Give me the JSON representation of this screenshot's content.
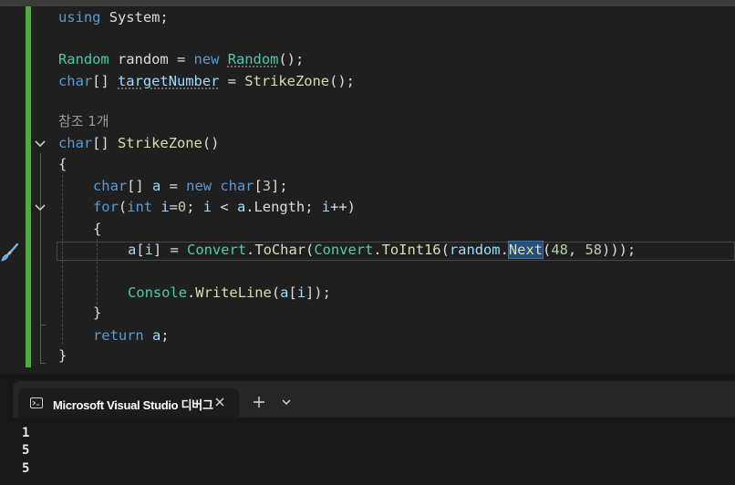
{
  "editor": {
    "lines": {
      "l1": {
        "kw": "using",
        "rest": " System;"
      },
      "l3": {
        "t1": "Random",
        "t2": " random = ",
        "kw": "new",
        "sp": " ",
        "t3": "Random",
        "t4": "();"
      },
      "l4": {
        "kw": "char",
        "t2": "[] ",
        "var": "targetNumber",
        "t3": " = ",
        "m": "StrikeZone",
        "t4": "();"
      },
      "lens": "참조 1개",
      "l6": {
        "kw": "char",
        "t2": "[] ",
        "m": "StrikeZone",
        "t4": "()"
      },
      "l7": "{",
      "l8": {
        "kw": "char",
        "t2": "[] ",
        "var": "a",
        "t3": " = ",
        "kw2": "new",
        "sp": " ",
        "kw3": "char",
        "t4": "[",
        "num": "3",
        "t5": "];"
      },
      "l9": {
        "kw": "for",
        "t1": "(",
        "kw2": "int",
        "t2": " ",
        "v1": "i",
        "t3": "=",
        "n1": "0",
        "t4": "; ",
        "v2": "i",
        "t5": " < ",
        "v3": "a",
        "t6": ".Length; ",
        "v4": "i",
        "t7": "++)"
      },
      "l10": "{",
      "l11": {
        "v1": "a",
        "t1": "[",
        "v2": "i",
        "t2": "] = ",
        "ty1": "Convert",
        "t3": ".",
        "m1": "ToChar",
        "t4": "(",
        "ty2": "Convert",
        "t5": ".",
        "m2": "ToInt16",
        "t6": "(",
        "v3": "random",
        "t7": ".",
        "m3": "Next",
        "t8": "(",
        "n1": "48",
        "t9": ", ",
        "n2": "58",
        "t10": ")));"
      },
      "l13": {
        "ty": "Console",
        "t1": ".",
        "m": "WriteLine",
        "t2": "(",
        "v1": "a",
        "t3": "[",
        "v2": "i",
        "t4": "]);"
      },
      "l14": "}",
      "l15": {
        "kw": "return",
        "sp": " ",
        "var": "a",
        "t": ";"
      },
      "l16": "}"
    }
  },
  "terminal": {
    "tab_label": "Microsoft Visual Studio 디버그",
    "output": [
      "1",
      "5",
      "5"
    ]
  },
  "colors": {
    "keyword": "#569cd6",
    "type": "#4ec9b0",
    "method": "#dcdcaa",
    "variable": "#9cdcfe",
    "number": "#b5cea8",
    "change_bar": "#4fab3a",
    "background": "#1f1f1f"
  },
  "icons": [
    "chevron-down-icon",
    "paintbrush-icon",
    "console-icon",
    "close-icon",
    "plus-icon",
    "chevron-down-icon"
  ]
}
